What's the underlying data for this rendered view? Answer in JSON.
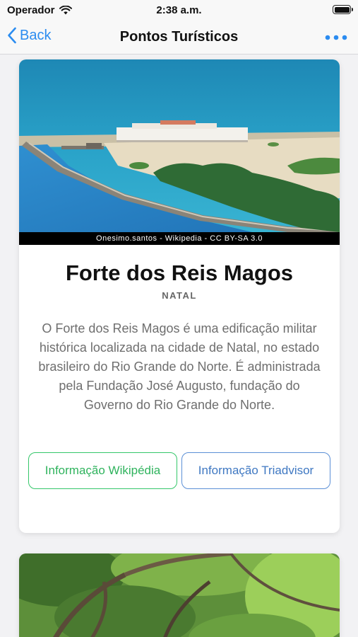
{
  "status_bar": {
    "carrier": "Operador",
    "time": "2:38 a.m."
  },
  "nav": {
    "back_label": "Back",
    "title": "Pontos Turísticos"
  },
  "cards": [
    {
      "photo_caption": "Onesimo.santos - Wikipedia - CC BY-SA 3.0",
      "title": "Forte dos Reis Magos",
      "city": "NATAL",
      "description": "O Forte dos Reis Magos é uma edificação militar histórica localizada na cidade de Natal, no estado brasileiro do Rio Grande do Norte. É administrada pela Fundação José Augusto, fundação do Governo do Rio Grande do Norte.",
      "wiki_button": "Informação Wikipédia",
      "trip_button": "Informação Triadvisor"
    }
  ],
  "colors": {
    "accent": "#2b8cf0",
    "wiki_green": "#35c76a",
    "trip_blue": "#5b8fd6"
  }
}
